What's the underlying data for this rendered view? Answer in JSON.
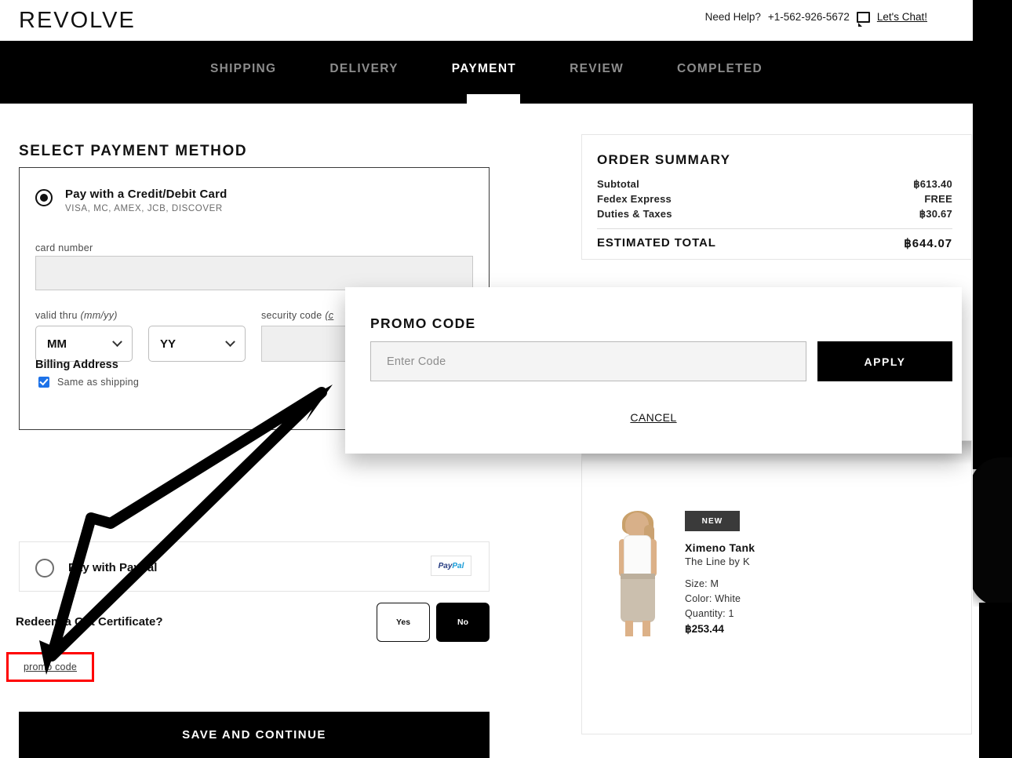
{
  "header": {
    "logo": "REVOLVE",
    "help_text": "Need Help?",
    "phone": "+1-562-926-5672",
    "chat_label": "Let's Chat!"
  },
  "steps": [
    {
      "label": "SHIPPING",
      "active": false
    },
    {
      "label": "DELIVERY",
      "active": false
    },
    {
      "label": "PAYMENT",
      "active": true
    },
    {
      "label": "REVIEW",
      "active": false
    },
    {
      "label": "COMPLETED",
      "active": false
    }
  ],
  "payment": {
    "section_title": "SELECT PAYMENT METHOD",
    "card": {
      "title": "Pay with a Credit/Debit Card",
      "subtitle": "VISA, MC, AMEX, JCB, DISCOVER",
      "card_number_label": "card number",
      "card_number_value": "",
      "valid_thru_label": "valid thru",
      "valid_thru_hint": "(mm/yy)",
      "month_value": "MM",
      "year_value": "YY",
      "security_label": "security code",
      "security_hint": "(c",
      "security_value": "",
      "billing_title": "Billing Address",
      "same_as_shipping_label": "Same as shipping",
      "same_as_shipping_checked": true
    },
    "paypal": {
      "title": "Pay with Paypal",
      "logo_part1": "Pay",
      "logo_part2": "Pal"
    },
    "gift": {
      "question": "Redeem a Gift Certificate?",
      "yes_label": "Yes",
      "no_label": "No",
      "selected": "No"
    },
    "promo_link_label": "promo code",
    "save_button_label": "SAVE AND CONTINUE"
  },
  "promo_modal": {
    "title": "PROMO CODE",
    "input_placeholder": "Enter Code",
    "input_value": "",
    "apply_label": "APPLY",
    "cancel_label": "CANCEL"
  },
  "order_summary": {
    "title": "ORDER SUMMARY",
    "rows": [
      {
        "label": "Subtotal",
        "value": "฿613.40"
      },
      {
        "label": "Fedex Express",
        "value": "FREE"
      },
      {
        "label": "Duties & Taxes",
        "value": "฿30.67"
      }
    ],
    "total_label": "ESTIMATED TOTAL",
    "total_value": "฿644.07"
  },
  "order_items": [
    {
      "badge": "NEW",
      "name": "Ximeno Tank",
      "brand": "The Line by K",
      "size": "Size:  M",
      "color": "Color:  White",
      "quantity": "Quantity: 1",
      "price": "฿253.44"
    }
  ],
  "colors": {
    "accent_black": "#000000",
    "highlight_red": "#ff0000",
    "checkbox_blue": "#1d72e8",
    "muted_step": "#8c8c8c"
  }
}
